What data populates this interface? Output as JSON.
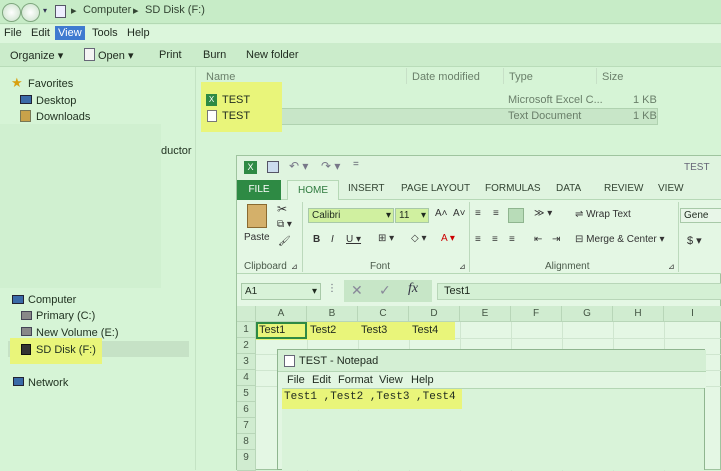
{
  "explorer": {
    "breadcrumb": [
      "Computer",
      "SD Disk (F:)"
    ],
    "menu": [
      "File",
      "Edit",
      "View",
      "Tools",
      "Help"
    ],
    "toolbar": [
      "Organize",
      "Open",
      "Print",
      "Burn",
      "New folder"
    ],
    "columns": [
      "Name",
      "Date modified",
      "Type",
      "Size"
    ],
    "files": [
      {
        "name": "TEST",
        "type": "Microsoft Excel C...",
        "size": "1 KB",
        "icon": "excel-file-icon"
      },
      {
        "name": "TEST",
        "type": "Text Document",
        "size": "1 KB",
        "icon": "text-file-icon"
      }
    ],
    "nav": {
      "favorites": "Favorites",
      "desktop": "Desktop",
      "downloads": "Downloads",
      "partial": "ductor",
      "computer": "Computer",
      "primary": "Primary (C:)",
      "new_volume": "New Volume (E:)",
      "sd_disk": "SD Disk (F:)",
      "network": "Network"
    }
  },
  "excel": {
    "title": "TEST",
    "tabs": [
      "FILE",
      "HOME",
      "INSERT",
      "PAGE LAYOUT",
      "FORMULAS",
      "DATA",
      "REVIEW",
      "VIEW"
    ],
    "ribbon": {
      "paste": "Paste",
      "font_name": "Calibri",
      "font_size": "11",
      "wrap_text": "Wrap Text",
      "merge_center": "Merge & Center",
      "number_format": "Gene",
      "currency": "$",
      "groups": [
        "Clipboard",
        "Font",
        "Alignment"
      ]
    },
    "name_box": "A1",
    "formula": "Test1",
    "columns": [
      "A",
      "B",
      "C",
      "D",
      "E",
      "F",
      "G",
      "H",
      "I"
    ],
    "rows": [
      "1",
      "2",
      "3",
      "4",
      "5",
      "6",
      "7",
      "8",
      "9"
    ],
    "row1": [
      "Test1",
      "Test2",
      "Test3",
      "Test4"
    ]
  },
  "notepad": {
    "title": "TEST - Notepad",
    "menu": [
      "File",
      "Edit",
      "Format",
      "View",
      "Help"
    ],
    "content": "Test1 ,Test2 ,Test3 ,Test4"
  },
  "colors": {
    "highlight": "#e9f57a",
    "excel_green": "#2e8a44",
    "selection_blue": "#3f7ad0"
  }
}
